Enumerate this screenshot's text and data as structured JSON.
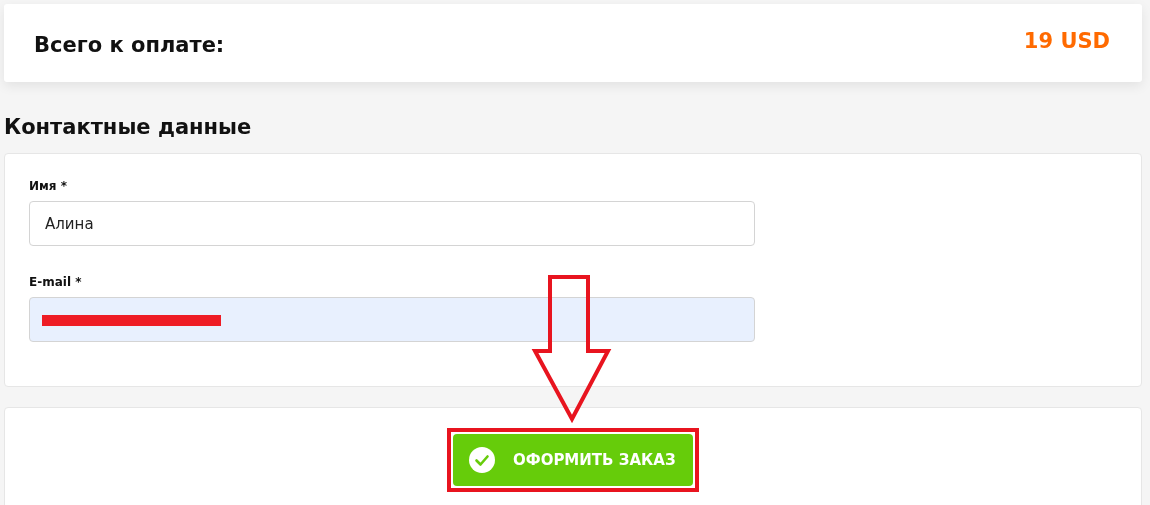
{
  "summary": {
    "label": "Всего к оплате:",
    "amount": "19 USD"
  },
  "contact": {
    "heading": "Контактные данные",
    "fields": [
      {
        "label": "Имя *",
        "value": "Алина",
        "autofilled": false,
        "redacted": false
      },
      {
        "label": "E-mail *",
        "autofilled": true,
        "redacted": true
      }
    ]
  },
  "submit": {
    "label": "ОФОРМИТЬ ЗАКАЗ",
    "highlighted": true
  },
  "annotation": {
    "kind": "arrow"
  }
}
